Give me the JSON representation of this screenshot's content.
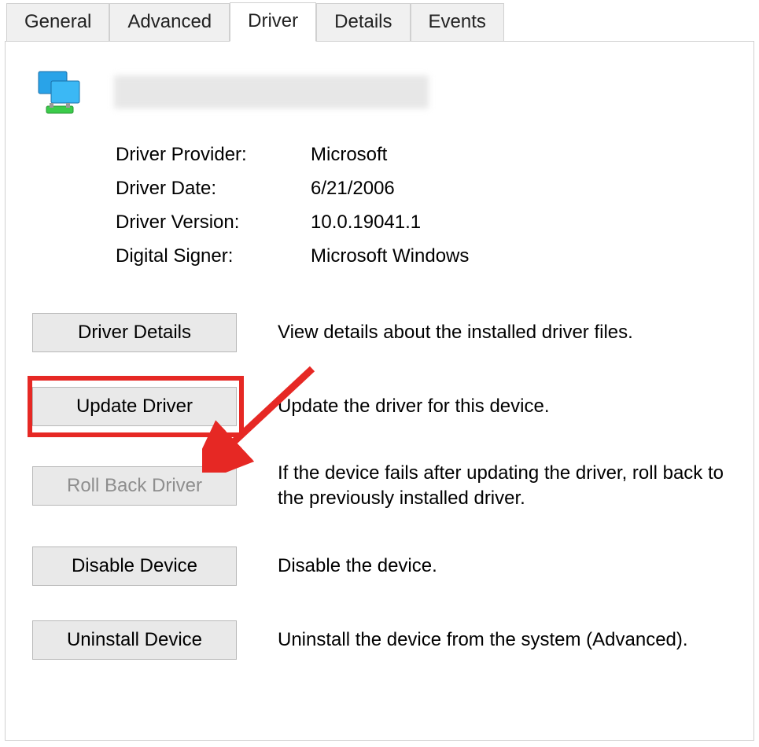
{
  "tabs": {
    "general": "General",
    "advanced": "Advanced",
    "driver": "Driver",
    "details": "Details",
    "events": "Events"
  },
  "info": {
    "provider_label": "Driver Provider:",
    "provider_value": "Microsoft",
    "date_label": "Driver Date:",
    "date_value": "6/21/2006",
    "version_label": "Driver Version:",
    "version_value": "10.0.19041.1",
    "signer_label": "Digital Signer:",
    "signer_value": "Microsoft Windows"
  },
  "buttons": {
    "details_label": "Driver Details",
    "details_desc": "View details about the installed driver files.",
    "update_label": "Update Driver",
    "update_desc": "Update the driver for this device.",
    "rollback_label": "Roll Back Driver",
    "rollback_desc": "If the device fails after updating the driver, roll back to the previously installed driver.",
    "disable_label": "Disable Device",
    "disable_desc": "Disable the device.",
    "uninstall_label": "Uninstall Device",
    "uninstall_desc": "Uninstall the device from the system (Advanced)."
  }
}
